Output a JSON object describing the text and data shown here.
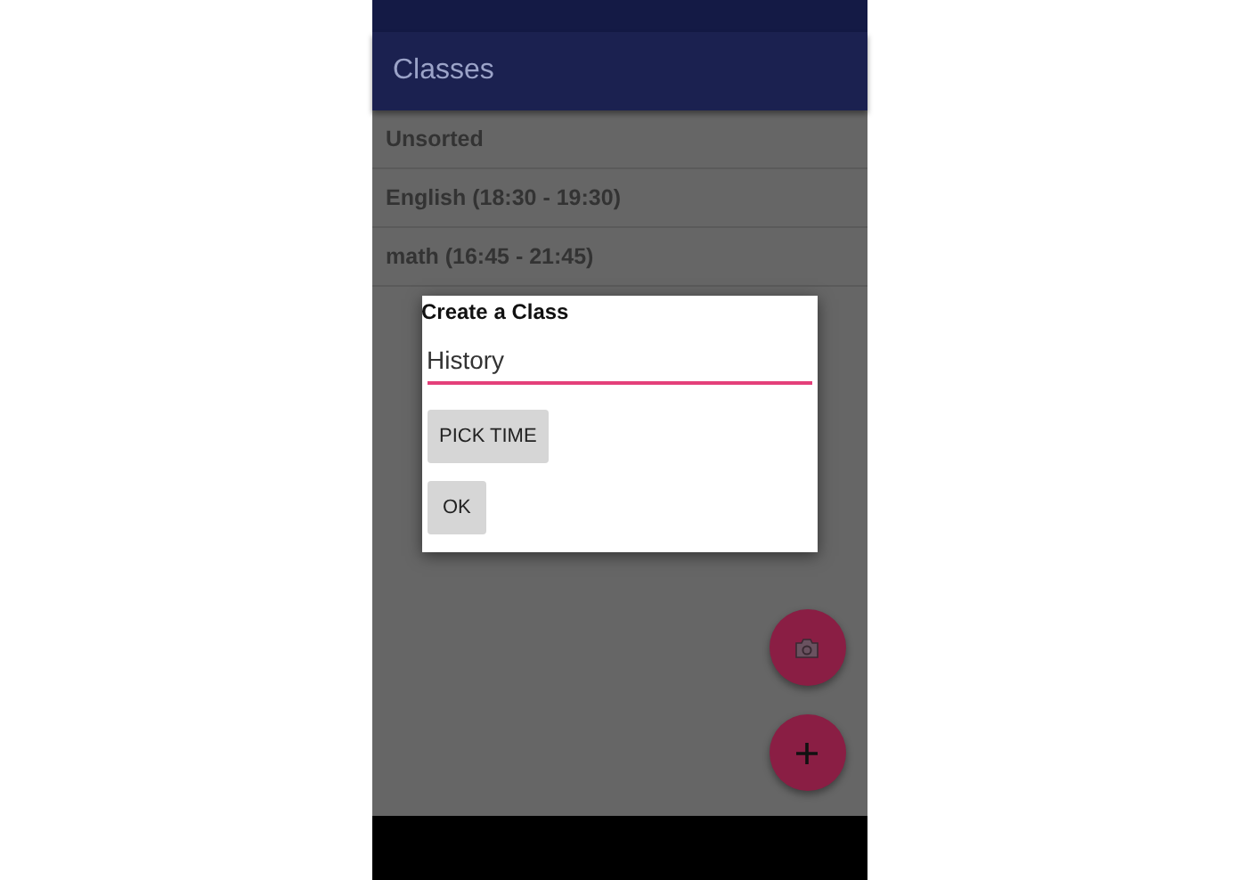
{
  "app_bar": {
    "title": "Classes"
  },
  "classes": [
    {
      "label": "Unsorted"
    },
    {
      "label": "English (18:30 - 19:30)"
    },
    {
      "label": "math (16:45 - 21:45)"
    }
  ],
  "dialog": {
    "title": "Create a Class",
    "name_field": {
      "value": "History"
    },
    "buttons": [
      {
        "label": "PICK TIME"
      },
      {
        "label": "OK"
      }
    ]
  },
  "fabs": [
    {
      "kind": "camera"
    },
    {
      "kind": "add"
    }
  ]
}
